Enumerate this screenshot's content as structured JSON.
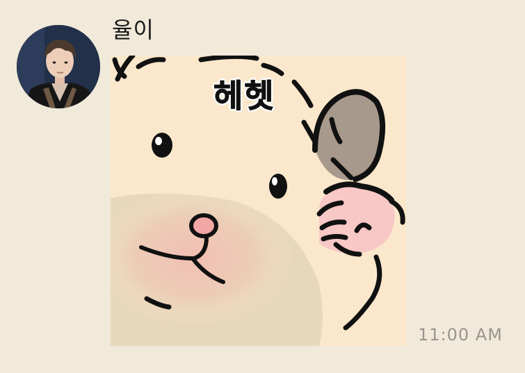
{
  "message": {
    "sender_name": "율이",
    "sticker_caption": "헤헷",
    "sticker_icon": "hamster-sticker",
    "timestamp": "11:00 AM"
  },
  "colors": {
    "chat_background": "#f1e9da",
    "sticker_background": "#fbe8cc",
    "timestamp_text": "#9a958c"
  }
}
